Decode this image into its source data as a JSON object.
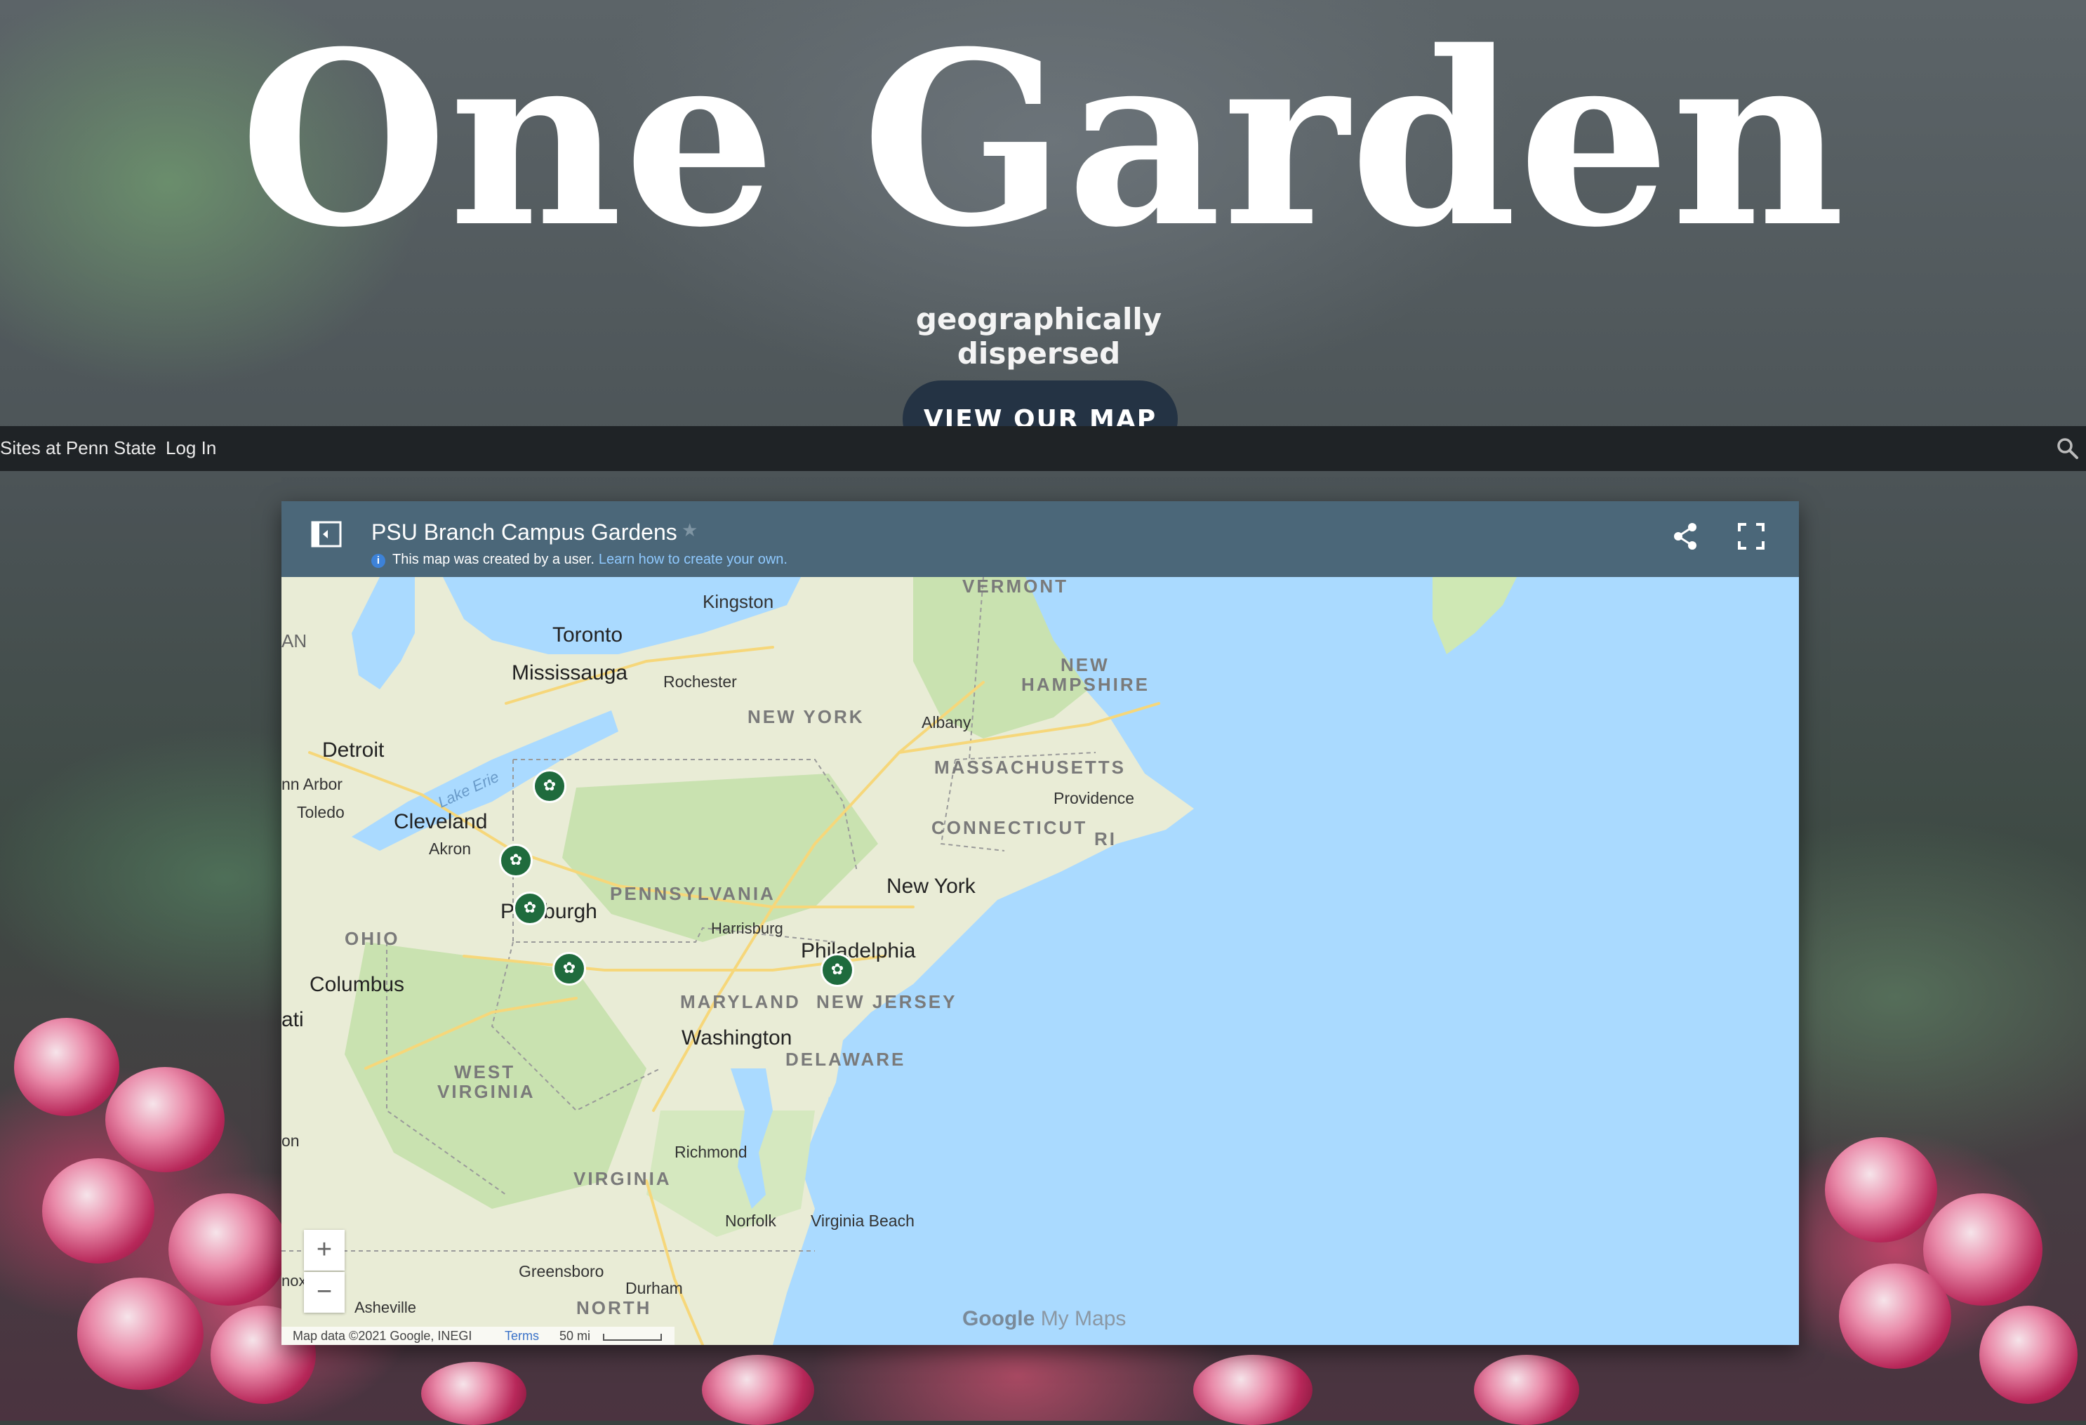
{
  "hero": {
    "title": "One Garden",
    "subtitle": "geographically dispersed",
    "cta_label": "VIEW OUR MAP"
  },
  "admin_bar": {
    "sites_label": "Sites at Penn State",
    "login_label": "Log In",
    "search_icon": "search-icon"
  },
  "map": {
    "title": "PSU Branch Campus Gardens",
    "note": "This map was created by a user.",
    "learn_link": "Learn how to create your own.",
    "zoom_in": "+",
    "zoom_out": "−",
    "attribution": "Map data ©2021 Google, INEGI",
    "terms": "Terms",
    "scale": "50 mi",
    "logo_google": "Google",
    "logo_mymaps": "My Maps",
    "labels": {
      "vermont": "VERMONT",
      "kingston": "Kingston",
      "toronto": "Toronto",
      "mississauga": "Mississauga",
      "rochester": "Rochester",
      "new_hampshire_1": "NEW",
      "new_hampshire_2": "HAMPSHIRE",
      "new_york_state": "NEW YORK",
      "albany": "Albany",
      "detroit": "Detroit",
      "ann_arbor": "nn Arbor",
      "toledo": "Toledo",
      "lake_erie": "Lake Erie",
      "massachusetts": "MASSACHUSETTS",
      "providence": "Providence",
      "cleveland": "Cleveland",
      "connecticut": "CONNECTICUT",
      "ri": "RI",
      "akron": "Akron",
      "pennsylvania": "PENNSYLVANIA",
      "new_york_city": "New York",
      "pittsburgh": "P     burgh",
      "ohio": "OHIO",
      "harrisburg": "Harrisburg",
      "philadelphia": "Philadelphia",
      "columbus": "Columbus",
      "cincinnati": "ati",
      "maryland": "MARYLAND",
      "new_jersey": "NEW JERSEY",
      "washington": "Washington",
      "delaware": "DELAWARE",
      "west_virginia_1": "WEST",
      "west_virginia_2": "VIRGINIA",
      "richmond": "Richmond",
      "virginia": "VIRGINIA",
      "norfolk": "Norfolk",
      "virginia_beach": "Virginia Beach",
      "greensboro": "Greensboro",
      "durham": "Durham",
      "asheville": "Asheville",
      "north_carolina": "NORTH",
      "edge_an": "AN",
      "edge_on": "on",
      "edge_knox": "nox"
    }
  },
  "colors": {
    "map_header": "#4b6779",
    "water": "#aadaff",
    "land": "#e8ecd9",
    "pin": "#1f6b3d",
    "admin_bar": "#1f2326",
    "cta": "#243344"
  }
}
